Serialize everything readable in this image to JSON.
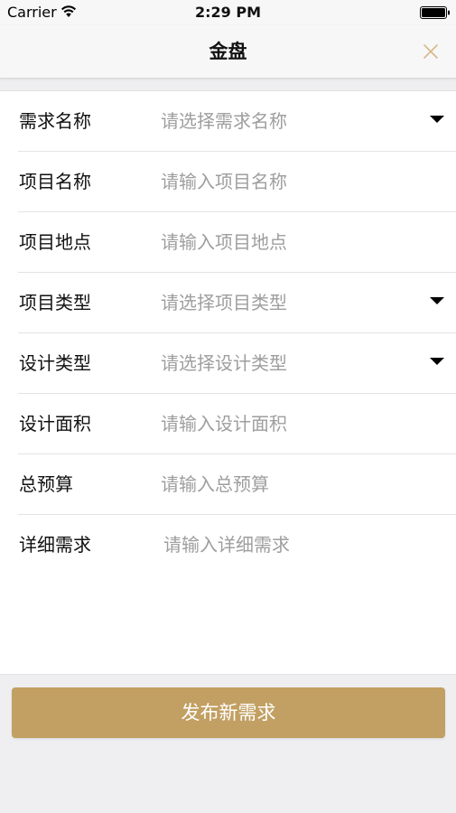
{
  "status_bar": {
    "carrier": "Carrier",
    "time": "2:29 PM"
  },
  "nav": {
    "title": "金盘"
  },
  "form": {
    "rows": [
      {
        "label": "需求名称",
        "placeholder": "请选择需求名称",
        "type": "select"
      },
      {
        "label": "项目名称",
        "placeholder": "请输入项目名称",
        "type": "input"
      },
      {
        "label": "项目地点",
        "placeholder": "请输入项目地点",
        "type": "input"
      },
      {
        "label": "项目类型",
        "placeholder": "请选择项目类型",
        "type": "select"
      },
      {
        "label": "设计类型",
        "placeholder": "请选择设计类型",
        "type": "select"
      },
      {
        "label": "设计面积",
        "placeholder": "请输入设计面积",
        "type": "input"
      },
      {
        "label": "总预算",
        "placeholder": "请输入总预算",
        "type": "input"
      }
    ],
    "detail": {
      "label": "详细需求",
      "placeholder": "请输入详细需求"
    }
  },
  "submit": {
    "label": "发布新需求"
  },
  "colors": {
    "accent": "#c2a063",
    "close_icon": "#d7b98a",
    "placeholder": "#9e9e9e",
    "background": "#efeff1"
  },
  "icons": {
    "wifi": "wifi-icon",
    "battery": "battery-icon",
    "close": "close-icon",
    "dropdown": "triangle-down-icon"
  }
}
